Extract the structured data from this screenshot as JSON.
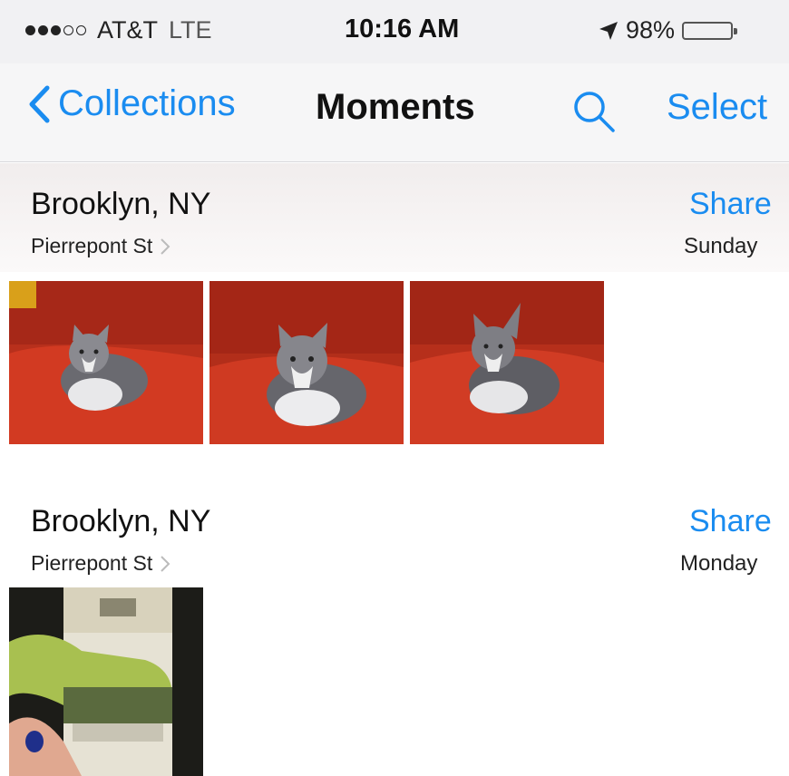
{
  "status_bar": {
    "carrier": "AT&T",
    "network": "LTE",
    "time": "10:16 AM",
    "battery_text": "98%",
    "battery_level": 0.98,
    "signal_bars": 3,
    "signal_total": 5
  },
  "nav": {
    "back_label": "Collections",
    "title": "Moments",
    "select_label": "Select"
  },
  "moments": [
    {
      "place": "Brooklyn, NY",
      "street": "Pierrepont St",
      "share_label": "Share",
      "day": "Sunday",
      "photo_count": 3
    },
    {
      "place": "Brooklyn, NY",
      "street": "Pierrepont St",
      "share_label": "Share",
      "day": "Monday",
      "photo_count": 1
    }
  ],
  "colors": {
    "accent": "#1a8cf0",
    "battery": "#4cd964",
    "couch": "#c8321e"
  },
  "icons": [
    "signal-dots-icon",
    "location-arrow-icon",
    "battery-icon",
    "back-chevron-icon",
    "search-icon",
    "chevron-right-icon"
  ]
}
